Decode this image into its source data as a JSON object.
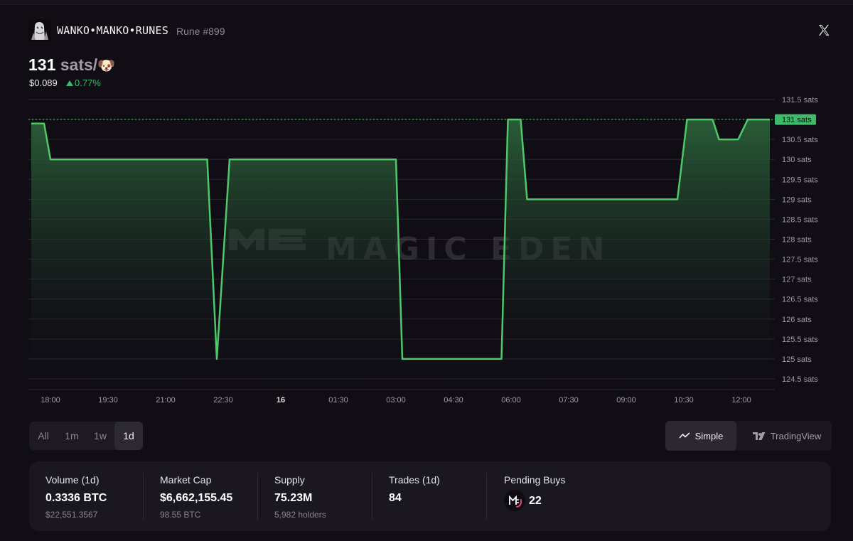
{
  "header": {
    "title": "WANKO•MANKO•RUNES",
    "rune_number": "Rune #899"
  },
  "price": {
    "value": "131",
    "unit": "sats/",
    "emoji": "🐶",
    "usd": "$0.089",
    "change": "0.77%"
  },
  "chart_data": {
    "type": "area",
    "watermark": "MAGIC EDEN",
    "x_ticks": [
      "18:00",
      "19:30",
      "21:00",
      "22:30",
      "16",
      "01:30",
      "03:00",
      "04:30",
      "06:00",
      "07:30",
      "09:00",
      "10:30",
      "12:00"
    ],
    "y_ticks": [
      "131.5 sats",
      "131 sats",
      "130.5 sats",
      "130 sats",
      "129.5 sats",
      "129 sats",
      "128.5 sats",
      "128 sats",
      "127.5 sats",
      "127 sats",
      "126.5 sats",
      "126 sats",
      "125.5 sats",
      "125 sats",
      "124.5 sats"
    ],
    "ylim": [
      124.5,
      131.5
    ],
    "current_label": "131 sats",
    "current_value": 131,
    "line_color": "#4ec96a",
    "series": [
      {
        "x": [
          "17:30",
          "17:50",
          "18:00",
          "22:05",
          "22:20",
          "22:40",
          "03:00",
          "03:10",
          "05:45",
          "05:55",
          "06:15",
          "06:25",
          "10:20",
          "10:35",
          "11:15",
          "11:25",
          "11:55",
          "12:10",
          "13:00"
        ],
        "values": [
          130.9,
          130.9,
          130,
          130,
          125,
          130,
          130,
          125,
          125,
          131,
          131,
          129,
          129,
          131,
          131,
          130.5,
          130.5,
          131,
          131
        ]
      }
    ]
  },
  "ranges": {
    "items": [
      "All",
      "1m",
      "1w",
      "1d"
    ],
    "active": "1d"
  },
  "views": {
    "simple": "Simple",
    "tradingview": "TradingView"
  },
  "stats": {
    "volume": {
      "label": "Volume (1d)",
      "value": "0.3336 BTC",
      "sub": "$22,551.3567"
    },
    "market_cap": {
      "label": "Market Cap",
      "value": "$6,662,155.45",
      "sub": "98.55 BTC"
    },
    "supply": {
      "label": "Supply",
      "value": "75.23M",
      "sub": "5,982 holders"
    },
    "trades": {
      "label": "Trades (1d)",
      "value": "84"
    },
    "pending_buys": {
      "label": "Pending Buys",
      "value": "22"
    }
  },
  "colors": {
    "background": "#100d14",
    "up_green": "#3fb96a",
    "panel": "#1a1720"
  }
}
